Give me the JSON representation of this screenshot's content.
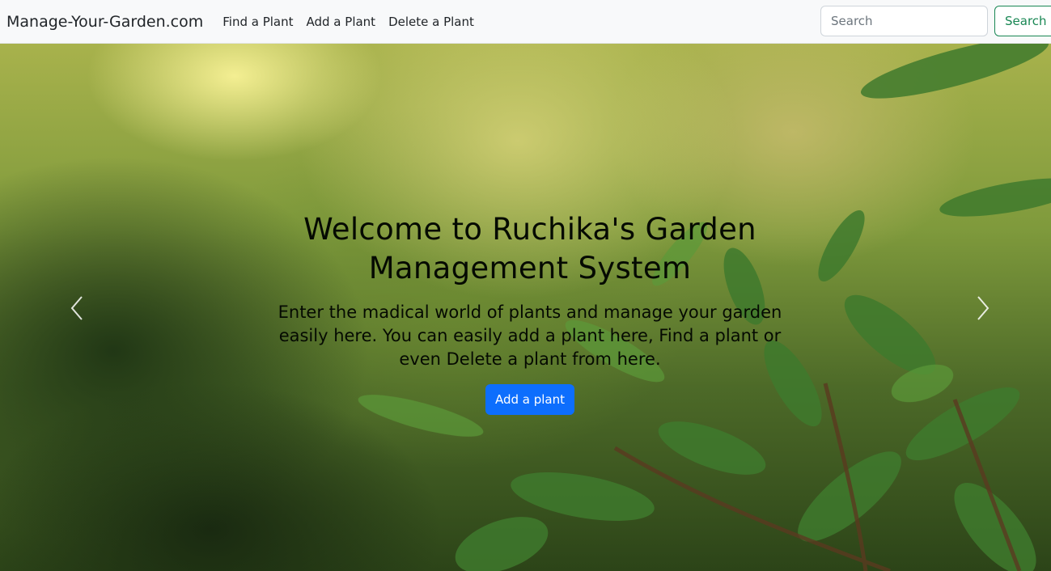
{
  "navbar": {
    "brand": "Manage-Your-Garden.com",
    "links": [
      "Find a Plant",
      "Add a Plant",
      "Delete a Plant"
    ],
    "search": {
      "placeholder": "Search",
      "button_label": "Search"
    }
  },
  "hero": {
    "title": "Welcome to Ruchika's Garden Management System",
    "description": "Enter the madical world of plants and manage your garden easily here. You can easily add a plant here, Find a plant or even Delete a plant from here.",
    "button_label": "Add a plant"
  },
  "carousel": {
    "prev_icon": "chevron-left-icon",
    "next_icon": "chevron-right-icon"
  },
  "colors": {
    "primary": "#0d6efd",
    "success": "#198754",
    "navbar_bg": "#f8f9fa"
  }
}
